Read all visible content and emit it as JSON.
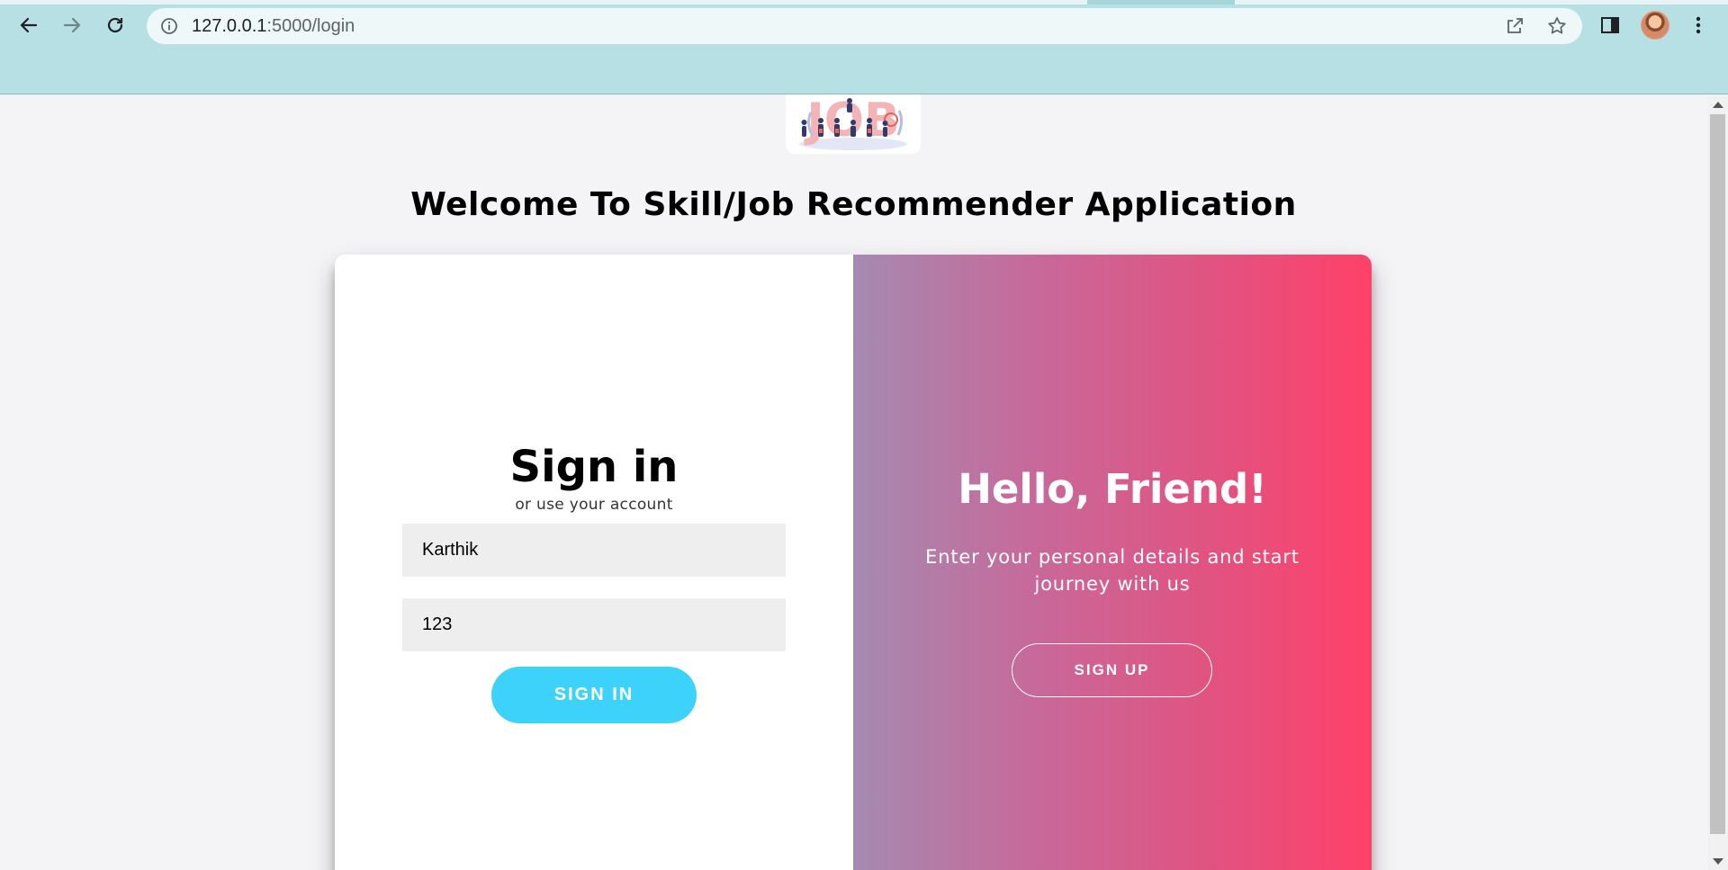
{
  "browser": {
    "url_host": "127.0.0.1",
    "url_rest": ":5000/login"
  },
  "page": {
    "welcome_title": "Welcome To Skill/Job Recommender Application",
    "logo_text": "JOB"
  },
  "signin": {
    "title": "Sign in",
    "subtitle": "or use your account",
    "username_value": "Karthik",
    "password_value": "123",
    "button_label": "SIGN IN"
  },
  "overlay": {
    "title": "Hello, Friend!",
    "text": "Enter your personal details and start journey with us",
    "button_label": "SIGN UP"
  },
  "colors": {
    "chrome_bg": "#b7e0e5",
    "signin_button": "#3dd2fa",
    "gradient_start": "#a58ab1",
    "gradient_end": "#ff4169"
  }
}
